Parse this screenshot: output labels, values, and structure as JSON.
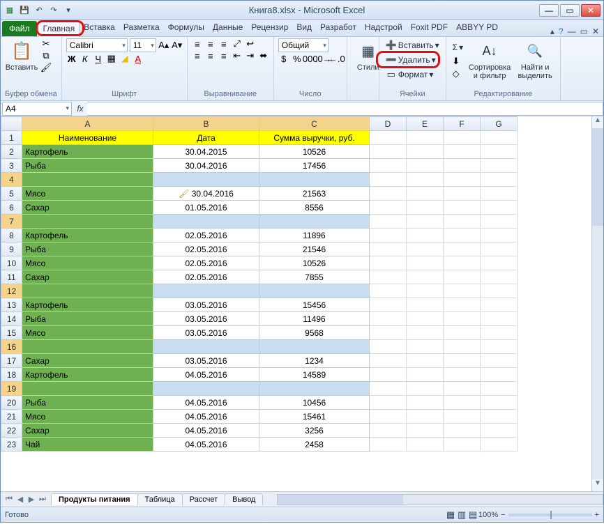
{
  "title": "Книга8.xlsx - Microsoft Excel",
  "qat": {
    "save": "💾",
    "undo": "↶",
    "redo": "↷"
  },
  "tabs": {
    "file": "Файл",
    "items": [
      "Главная",
      "Вставка",
      "Разметка",
      "Формулы",
      "Данные",
      "Рецензир",
      "Вид",
      "Разработ",
      "Надстрой",
      "Foxit PDF",
      "ABBYY PD"
    ],
    "active_index": 0
  },
  "ribbon": {
    "clipboard": {
      "paste": "Вставить",
      "label": "Буфер обмена"
    },
    "font": {
      "name": "Calibri",
      "size": "11",
      "label": "Шрифт"
    },
    "align": {
      "label": "Выравнивание"
    },
    "number": {
      "format": "Общий",
      "label": "Число"
    },
    "styles": {
      "btn": "Стили",
      "label": ""
    },
    "cells": {
      "insert": "Вставить",
      "delete": "Удалить",
      "format": "Формат",
      "label": "Ячейки"
    },
    "editing": {
      "sort": "Сортировка и фильтр",
      "find": "Найти и выделить",
      "sum": "Σ",
      "label": "Редактирование"
    }
  },
  "namebox": "A4",
  "fx_label": "fx",
  "columns": [
    "A",
    "B",
    "C",
    "D",
    "E",
    "F",
    "G"
  ],
  "headers": {
    "a": "Наименование",
    "b": "Дата",
    "c": "Сумма выручки, руб."
  },
  "rows": [
    {
      "n": 2,
      "a": "Картофель",
      "b": "30.04.2015",
      "c": "10526"
    },
    {
      "n": 3,
      "a": "Рыба",
      "b": "30.04.2016",
      "c": "17456"
    },
    {
      "n": 4,
      "a": "",
      "b": "",
      "c": "",
      "empty": true,
      "brush": false
    },
    {
      "n": 5,
      "a": "Мясо",
      "b": "30.04.2016",
      "c": "21563",
      "brush": true
    },
    {
      "n": 6,
      "a": "Сахар",
      "b": "01.05.2016",
      "c": "8556"
    },
    {
      "n": 7,
      "a": "",
      "b": "",
      "c": "",
      "empty": true
    },
    {
      "n": 8,
      "a": "Картофель",
      "b": "02.05.2016",
      "c": "11896"
    },
    {
      "n": 9,
      "a": "Рыба",
      "b": "02.05.2016",
      "c": "21546"
    },
    {
      "n": 10,
      "a": "Мясо",
      "b": "02.05.2016",
      "c": "10526"
    },
    {
      "n": 11,
      "a": "Сахар",
      "b": "02.05.2016",
      "c": "7855"
    },
    {
      "n": 12,
      "a": "",
      "b": "",
      "c": "",
      "empty": true
    },
    {
      "n": 13,
      "a": "Картофель",
      "b": "03.05.2016",
      "c": "15456"
    },
    {
      "n": 14,
      "a": "Рыба",
      "b": "03.05.2016",
      "c": "11496"
    },
    {
      "n": 15,
      "a": "Мясо",
      "b": "03.05.2016",
      "c": "9568"
    },
    {
      "n": 16,
      "a": "",
      "b": "",
      "c": "",
      "empty": true
    },
    {
      "n": 17,
      "a": "Сахар",
      "b": "03.05.2016",
      "c": "1234"
    },
    {
      "n": 18,
      "a": "Картофель",
      "b": "04.05.2016",
      "c": "14589"
    },
    {
      "n": 19,
      "a": "",
      "b": "",
      "c": "",
      "empty": true
    },
    {
      "n": 20,
      "a": "Рыба",
      "b": "04.05.2016",
      "c": "10456"
    },
    {
      "n": 21,
      "a": "Мясо",
      "b": "04.05.2016",
      "c": "15461"
    },
    {
      "n": 22,
      "a": "Сахар",
      "b": "04.05.2016",
      "c": "3256"
    },
    {
      "n": 23,
      "a": "Чай",
      "b": "04.05.2016",
      "c": "2458"
    }
  ],
  "sheet_tabs": [
    "Продукты питания",
    "Таблица",
    "Рассчет",
    "Вывод"
  ],
  "active_sheet": 0,
  "status": {
    "ready": "Готово",
    "zoom": "100%"
  }
}
